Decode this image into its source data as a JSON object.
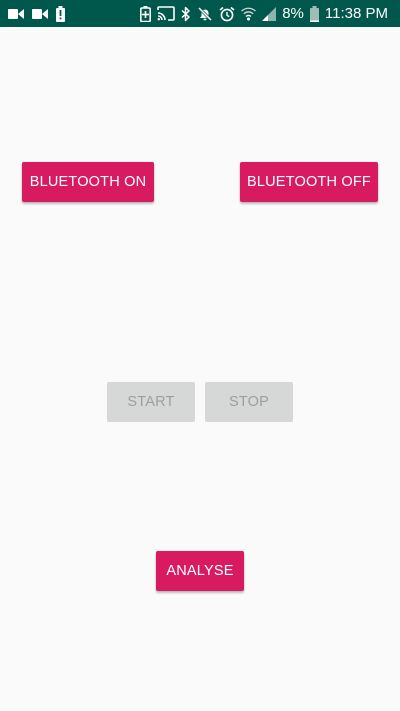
{
  "status_bar": {
    "battery_percent": "8%",
    "time": "11:38 PM",
    "background_color": "#00574b",
    "left_icons": [
      "video-camera-icon",
      "video-camera-icon",
      "battery-alert-icon"
    ],
    "right_icons": [
      "battery-saver-icon",
      "cast-icon",
      "bluetooth-icon",
      "mute-icon",
      "alarm-icon",
      "wifi-icon",
      "signal-icon",
      "battery-icon"
    ]
  },
  "buttons": {
    "bluetooth_on": "BLUETOOTH ON",
    "bluetooth_off": "BLUETOOTH OFF",
    "start": "START",
    "stop": "STOP",
    "analyse": "ANALYSE"
  },
  "colors": {
    "accent": "#d81b60",
    "disabled_bg": "#d6d7d7",
    "disabled_text": "#9e9e9e",
    "background": "#fafafa"
  }
}
